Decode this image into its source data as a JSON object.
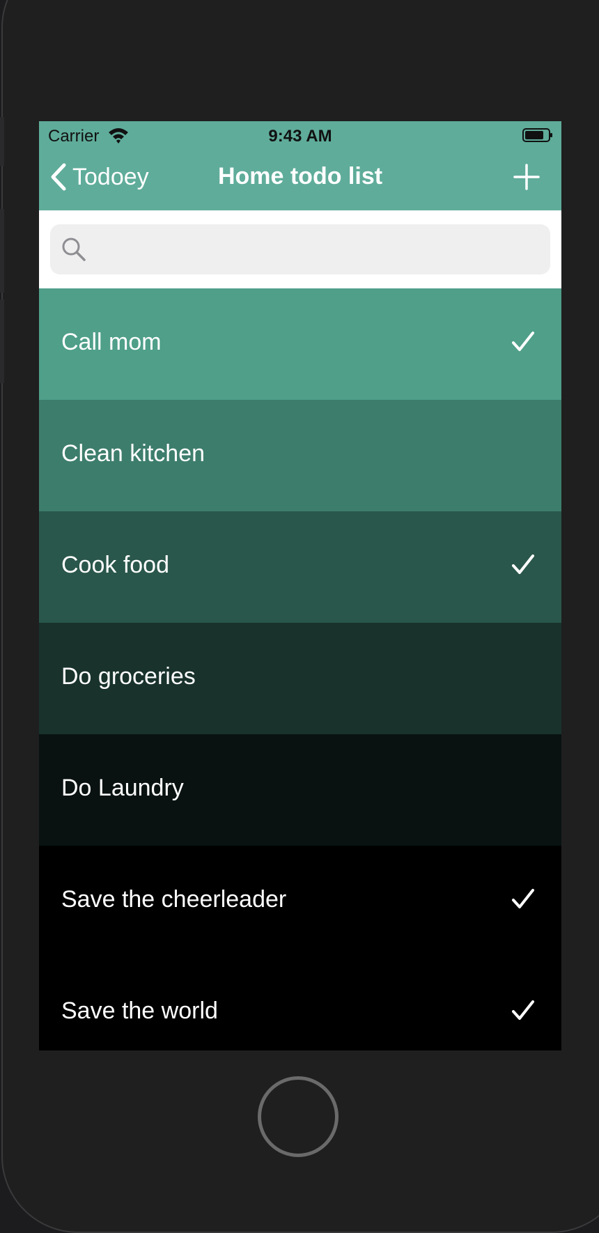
{
  "status_bar": {
    "carrier": "Carrier",
    "time": "9:43 AM"
  },
  "nav": {
    "back_label": "Todoey",
    "title": "Home todo list",
    "background": "#5fac9a"
  },
  "search": {
    "placeholder": "",
    "value": ""
  },
  "items": [
    {
      "title": "Call mom",
      "done": true,
      "color": "#4f9f89"
    },
    {
      "title": "Clean kitchen",
      "done": false,
      "color": "#3d7d6c"
    },
    {
      "title": "Cook food",
      "done": true,
      "color": "#2a574b"
    },
    {
      "title": "Do groceries",
      "done": false,
      "color": "#19322c"
    },
    {
      "title": "Do Laundry",
      "done": false,
      "color": "#091211"
    },
    {
      "title": "Save the cheerleader",
      "done": true,
      "color": "#000000"
    },
    {
      "title": "Save the world",
      "done": true,
      "color": "#000000"
    }
  ]
}
